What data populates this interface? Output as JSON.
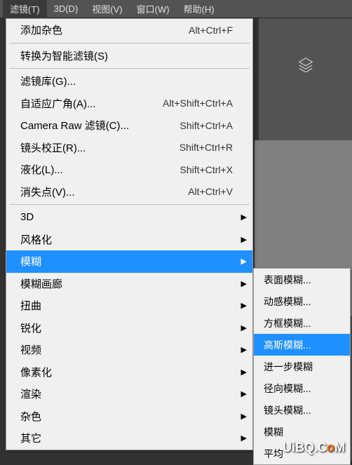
{
  "menubar": {
    "items": [
      {
        "label": "滤镜(T)",
        "active": true
      },
      {
        "label": "3D(D)"
      },
      {
        "label": "视图(V)"
      },
      {
        "label": "窗口(W)"
      },
      {
        "label": "帮助(H)"
      }
    ]
  },
  "dropdown": {
    "groups": [
      [
        {
          "label": "添加杂色",
          "shortcut": "Alt+Ctrl+F"
        }
      ],
      [
        {
          "label": "转换为智能滤镜(S)"
        }
      ],
      [
        {
          "label": "滤镜库(G)..."
        },
        {
          "label": "自适应广角(A)...",
          "shortcut": "Alt+Shift+Ctrl+A"
        },
        {
          "label": "Camera Raw 滤镜(C)...",
          "shortcut": "Shift+Ctrl+A"
        },
        {
          "label": "镜头校正(R)...",
          "shortcut": "Shift+Ctrl+R"
        },
        {
          "label": "液化(L)...",
          "shortcut": "Shift+Ctrl+X"
        },
        {
          "label": "消失点(V)...",
          "shortcut": "Alt+Ctrl+V"
        }
      ],
      [
        {
          "label": "3D",
          "submenu": true
        },
        {
          "label": "风格化",
          "submenu": true
        },
        {
          "label": "模糊",
          "submenu": true,
          "highlighted": true
        },
        {
          "label": "模糊画廊",
          "submenu": true
        },
        {
          "label": "扭曲",
          "submenu": true
        },
        {
          "label": "锐化",
          "submenu": true
        },
        {
          "label": "视频",
          "submenu": true
        },
        {
          "label": "像素化",
          "submenu": true
        },
        {
          "label": "渲染",
          "submenu": true
        },
        {
          "label": "杂色",
          "submenu": true
        },
        {
          "label": "其它",
          "submenu": true
        }
      ]
    ]
  },
  "submenu": {
    "items": [
      {
        "label": "表面模糊..."
      },
      {
        "label": "动感模糊..."
      },
      {
        "label": "方框模糊..."
      },
      {
        "label": "高斯模糊...",
        "highlighted": true
      },
      {
        "label": "进一步模糊"
      },
      {
        "label": "径向模糊..."
      },
      {
        "label": "镜头模糊..."
      },
      {
        "label": "模糊"
      },
      {
        "label": "平均"
      }
    ]
  },
  "watermark": {
    "prefix": "UiBQ.C",
    "suffix": "M",
    "o": "o"
  }
}
